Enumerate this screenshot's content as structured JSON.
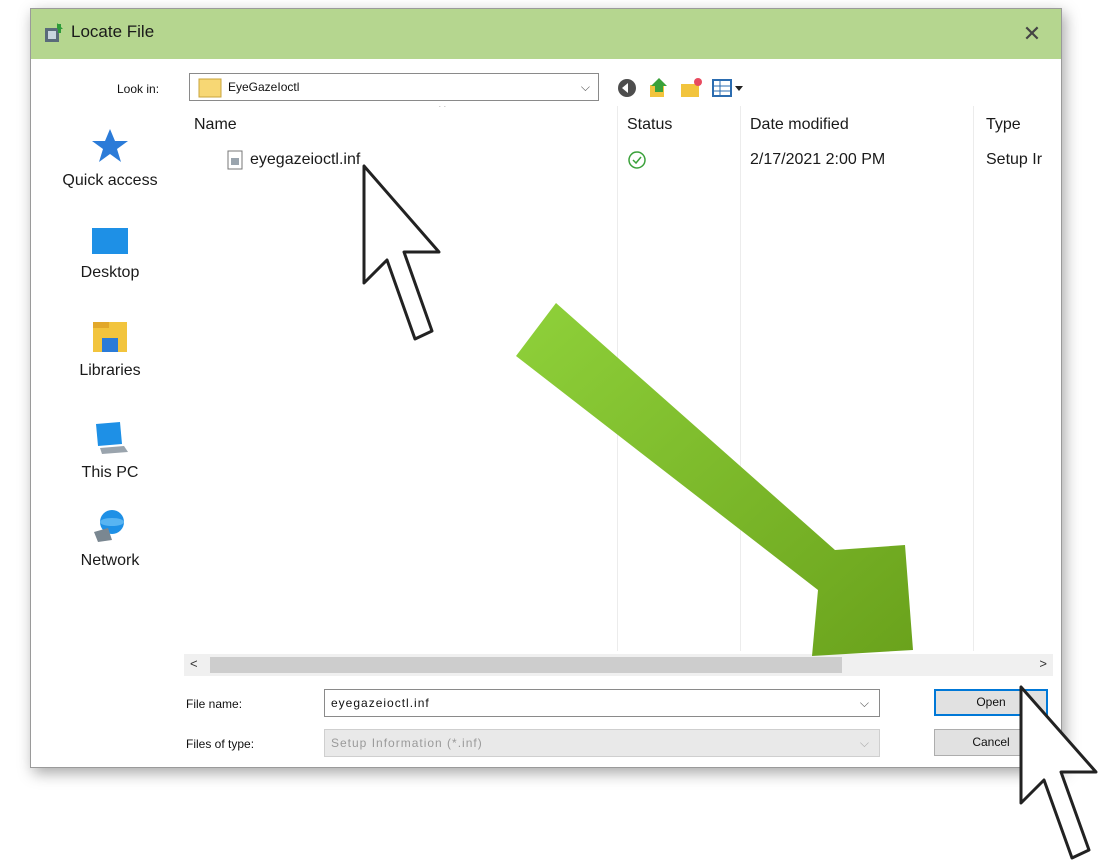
{
  "window": {
    "title": "Locate File",
    "close_glyph": "✕",
    "titlebar_color": "#b5d68f"
  },
  "toolbar": {
    "look_in_label": "Look in:",
    "look_in_value": "EyeGazeIoctl",
    "buttons": [
      "back-icon",
      "up-folder-icon",
      "new-folder-icon",
      "view-menu-icon"
    ]
  },
  "places": [
    {
      "label": "Quick access",
      "icon": "star-icon"
    },
    {
      "label": "Desktop",
      "icon": "desktop-icon"
    },
    {
      "label": "Libraries",
      "icon": "libraries-icon"
    },
    {
      "label": "This PC",
      "icon": "this-pc-icon"
    },
    {
      "label": "Network",
      "icon": "network-icon"
    }
  ],
  "file_list": {
    "columns": [
      "Name",
      "Status",
      "Date modified",
      "Type"
    ],
    "sort_glyph": "^",
    "rows": [
      {
        "name": "eyegazeioctl.inf",
        "status_icon": "sync-ok-icon",
        "date_modified": "2/17/2021 2:00 PM",
        "type": "Setup Ir"
      }
    ]
  },
  "scrollbar": {
    "left_glyph": "<",
    "right_glyph": ">"
  },
  "footer": {
    "file_name_label": "File name:",
    "file_name_value": "eyegazeioctl.inf",
    "files_of_type_label": "Files of type:",
    "files_of_type_value": "Setup Information (*.inf)",
    "open_label": "Open",
    "cancel_label": "Cancel",
    "dropdown_glyph": "⌵"
  },
  "annotation": {
    "arrow_color": "#7cb324"
  }
}
